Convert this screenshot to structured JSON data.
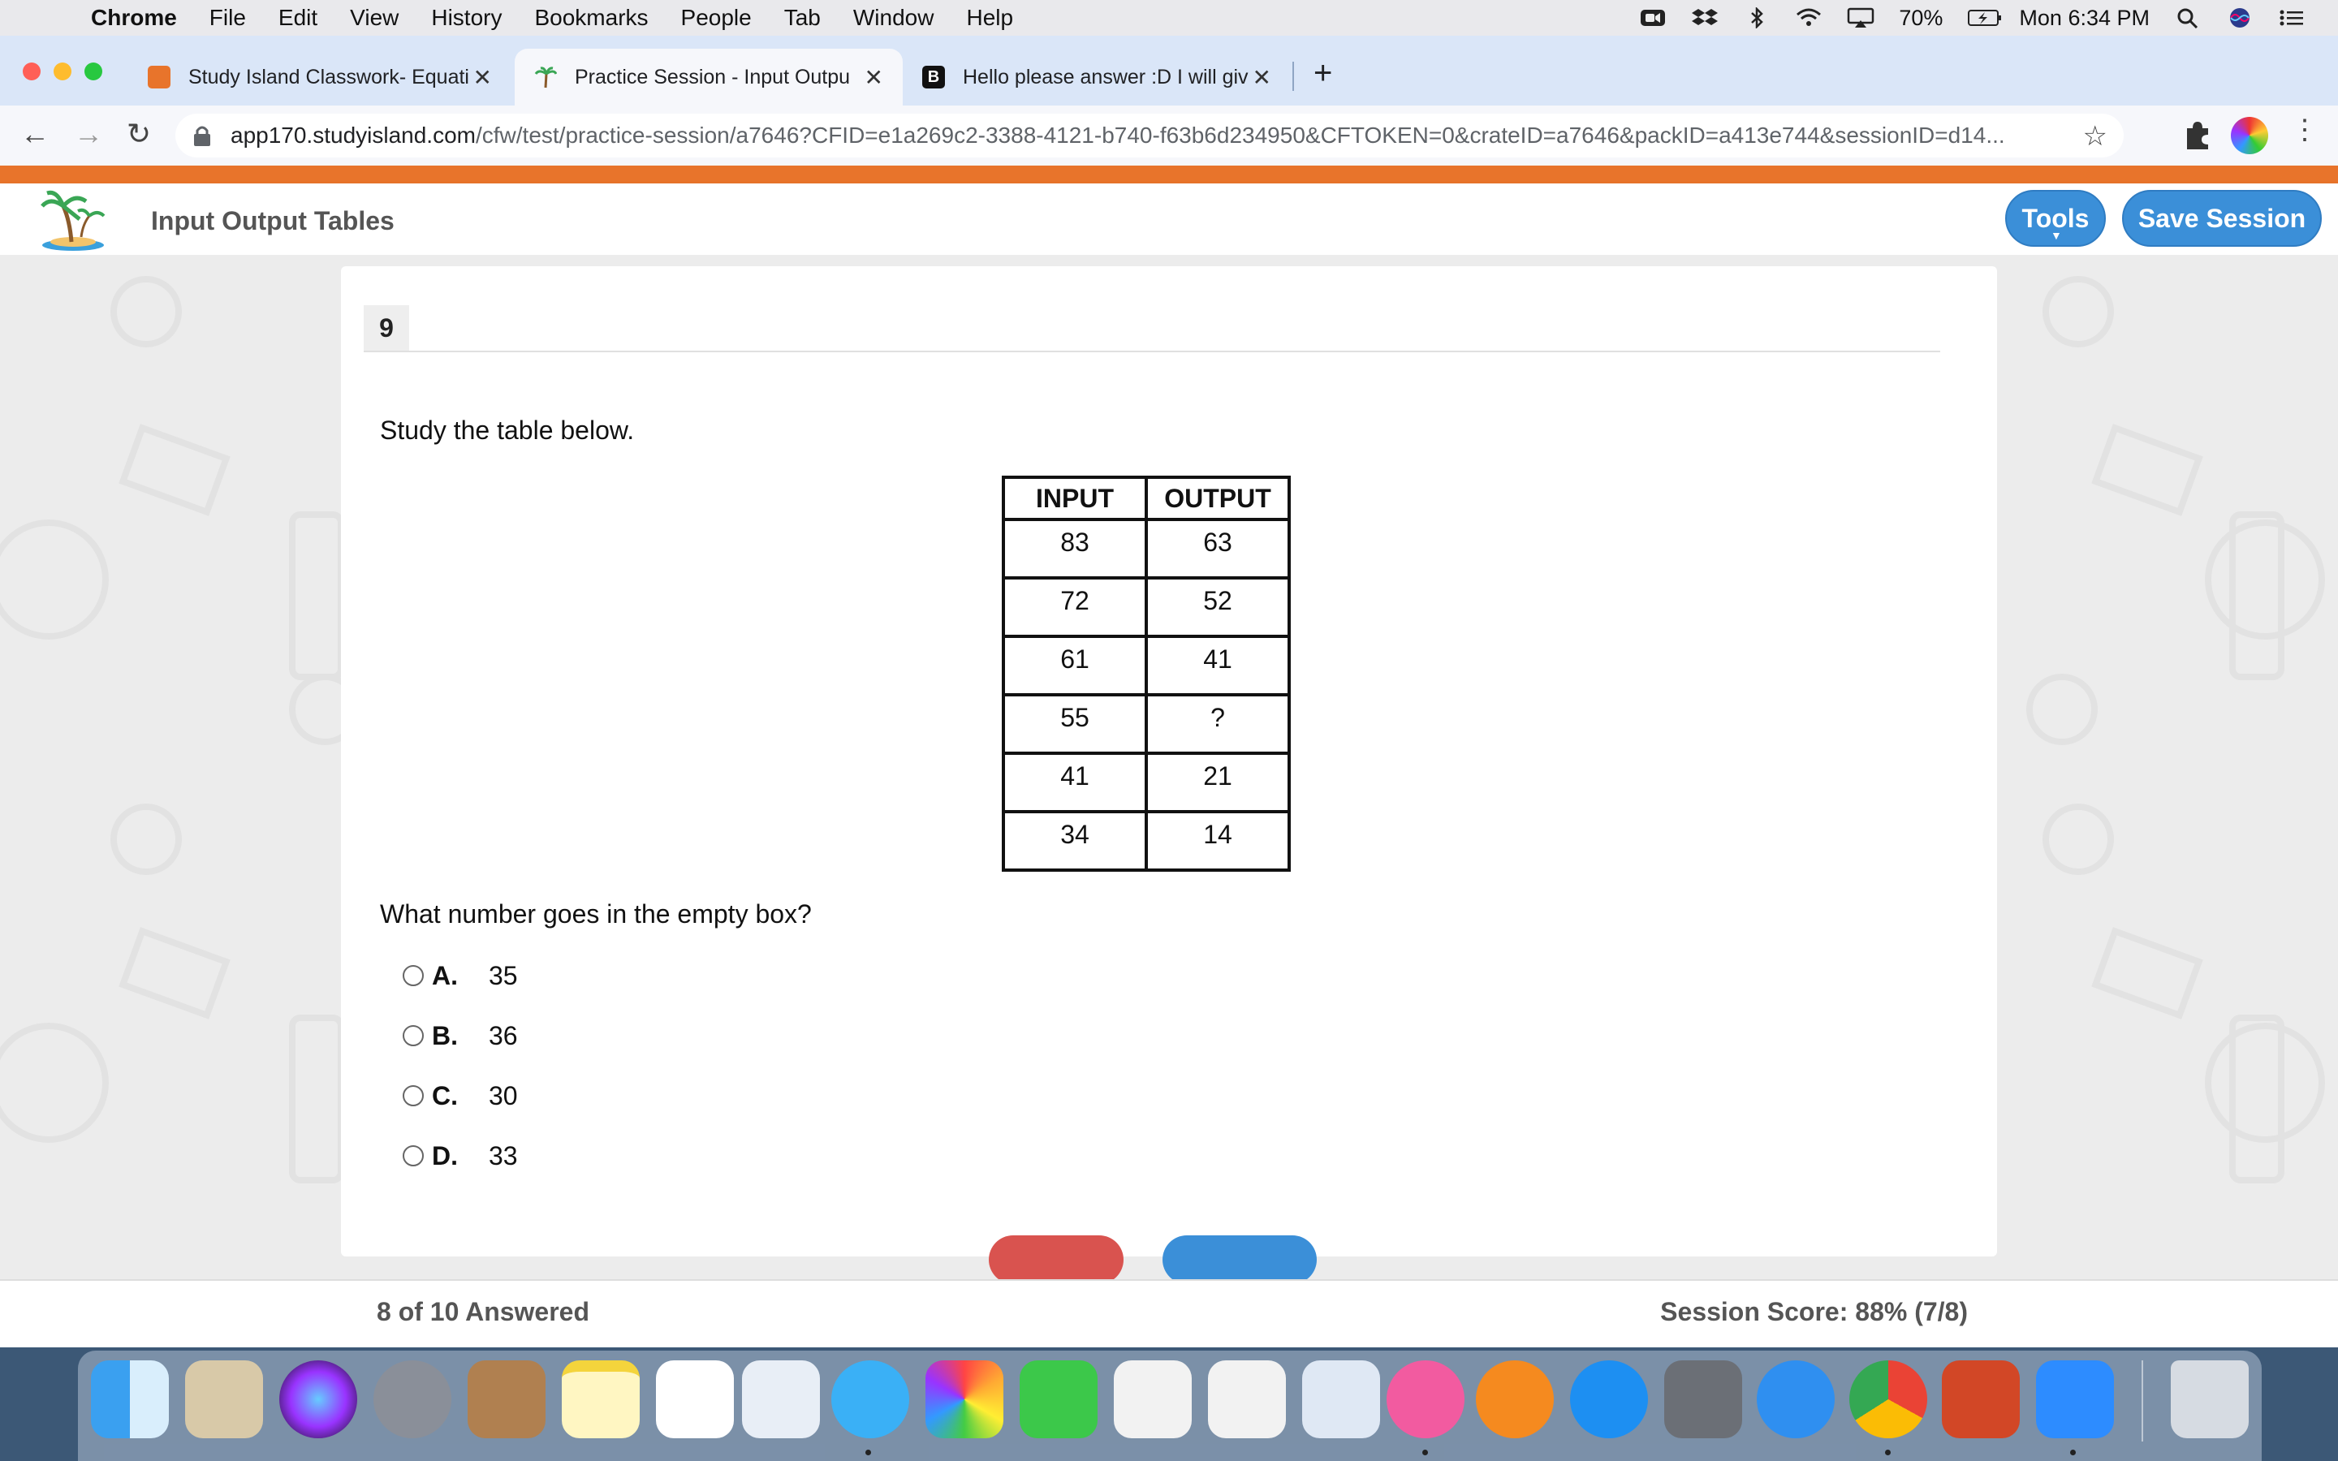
{
  "menubar": {
    "app": "Chrome",
    "items": [
      "File",
      "Edit",
      "View",
      "History",
      "Bookmarks",
      "People",
      "Tab",
      "Window",
      "Help"
    ],
    "battery": "70%",
    "clock": "Mon 6:34 PM"
  },
  "tabs": [
    {
      "title": "Study Island Classwork- Equati",
      "active": false
    },
    {
      "title": "Practice Session - Input Outpu",
      "active": true
    },
    {
      "title": "Hello please answer :D I will giv",
      "active": false
    }
  ],
  "address": {
    "host": "app170.studyisland.com",
    "path": "/cfw/test/practice-session/a7646?CFID=e1a269c2-3388-4121-b740-f63b6d234950&CFTOKEN=0&crateID=a7646&packID=a413e744&sessionID=d14..."
  },
  "header": {
    "page_title": "Input Output Tables",
    "tools_label": "Tools",
    "save_label": "Save Session"
  },
  "question": {
    "number": "9",
    "prompt": "Study the table below.",
    "table_headers": [
      "INPUT",
      "OUTPUT"
    ],
    "rows": [
      [
        "83",
        "63"
      ],
      [
        "72",
        "52"
      ],
      [
        "61",
        "41"
      ],
      [
        "55",
        "?"
      ],
      [
        "41",
        "21"
      ],
      [
        "34",
        "14"
      ]
    ],
    "ask": "What number goes in the empty box?",
    "options": [
      {
        "letter": "A.",
        "value": "35"
      },
      {
        "letter": "B.",
        "value": "36"
      },
      {
        "letter": "C.",
        "value": "30"
      },
      {
        "letter": "D.",
        "value": "33"
      }
    ],
    "reset_color": "#d9534f",
    "submit_color": "#3b8fd8"
  },
  "footer": {
    "answered": "8 of 10 Answered",
    "score": "Session Score: 88% (7/8)"
  },
  "dock": [
    "finder",
    "mail",
    "siri",
    "launchpad",
    "contacts",
    "notes",
    "reminders",
    "preview",
    "messages",
    "photos",
    "facetime",
    "pages",
    "numbers",
    "keynote",
    "itunes",
    "books",
    "app-store",
    "system-preferences",
    "safari",
    "chrome",
    "powerpoint",
    "zoom",
    "trash"
  ]
}
